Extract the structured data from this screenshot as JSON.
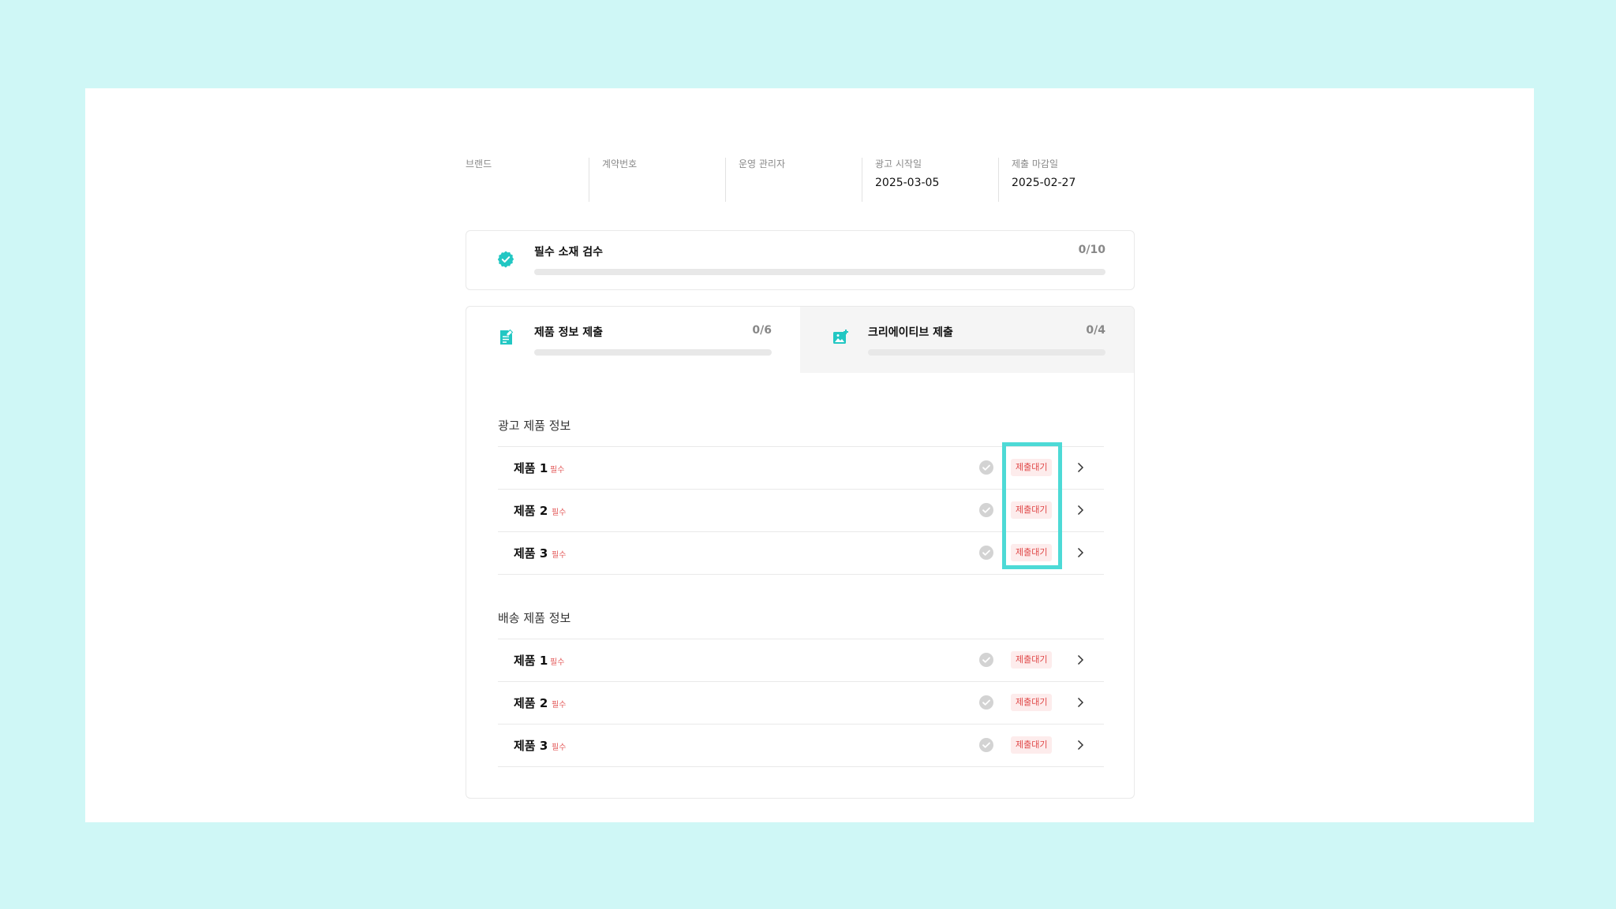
{
  "meta": [
    {
      "label": "브랜드",
      "value": ""
    },
    {
      "label": "계약번호",
      "value": ""
    },
    {
      "label": "운영 관리자",
      "value": ""
    },
    {
      "label": "광고 시작일",
      "value": "2025-03-05"
    },
    {
      "label": "제출 마감일",
      "value": "2025-02-27"
    }
  ],
  "inspection": {
    "title": "필수 소재 검수",
    "count": "0/10",
    "progress": 0
  },
  "tabs": [
    {
      "title": "제품 정보 제출",
      "count": "0/6",
      "progress": 0,
      "active": true,
      "icon": "document-edit-icon"
    },
    {
      "title": "크리에이티브 제출",
      "count": "0/4",
      "progress": 0,
      "active": false,
      "icon": "image-add-icon"
    }
  ],
  "sections": [
    {
      "title": "광고 제품 정보",
      "items": [
        {
          "name": "제품 1",
          "required": "필수",
          "status": "제출대기"
        },
        {
          "name": "제품 2",
          "required": "필수",
          "status": "제출대기"
        },
        {
          "name": "제품 3",
          "required": "필수",
          "status": "제출대기"
        }
      ]
    },
    {
      "title": "배송 제품 정보",
      "items": [
        {
          "name": "제품 1",
          "required": "필수",
          "status": "제출대기"
        },
        {
          "name": "제품 2",
          "required": "필수",
          "status": "제출대기"
        },
        {
          "name": "제품 3",
          "required": "필수",
          "status": "제출대기"
        }
      ]
    }
  ],
  "colors": {
    "accent": "#22c7c3",
    "status_text": "#e04848",
    "status_bg": "#fdecec",
    "highlight": "#4ddad6"
  }
}
